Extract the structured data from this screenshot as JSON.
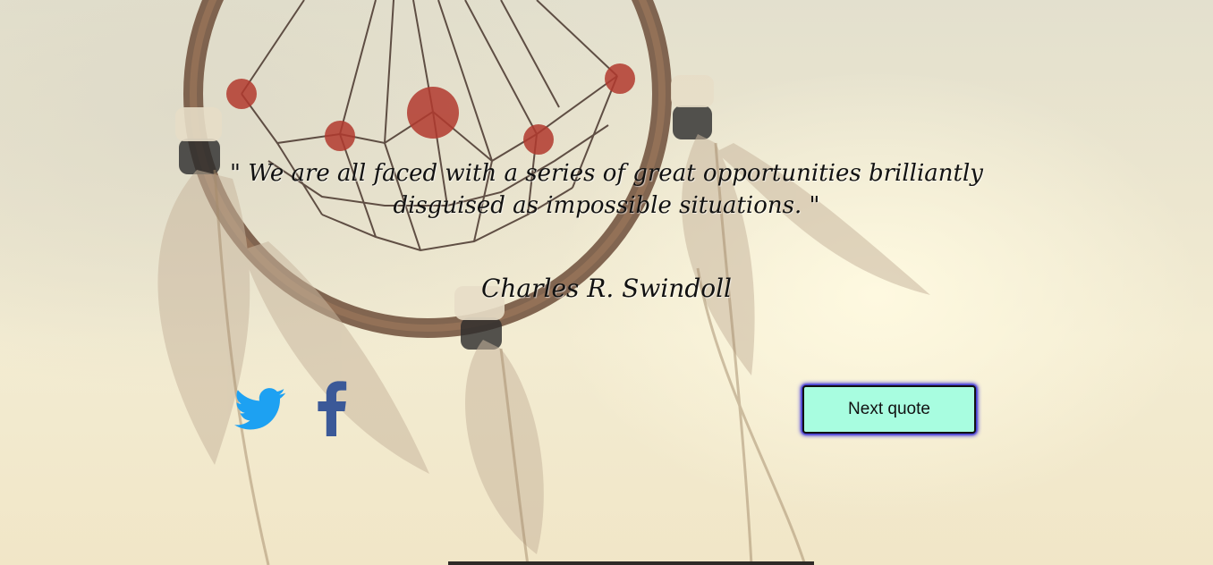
{
  "quote": {
    "text": "\" We are all faced with a series of great opportunities brilliantly disguised as impossible situations. \"",
    "author": "Charles R. Swindoll"
  },
  "actions": {
    "next_label": "Next quote"
  },
  "share": {
    "twitter_icon": "twitter-bird-icon",
    "facebook_icon": "facebook-f-icon"
  },
  "colors": {
    "twitter": "#1da1f2",
    "facebook": "#3b5998",
    "button_bg": "#a8fde0",
    "button_glow": "#3a2fe0"
  }
}
